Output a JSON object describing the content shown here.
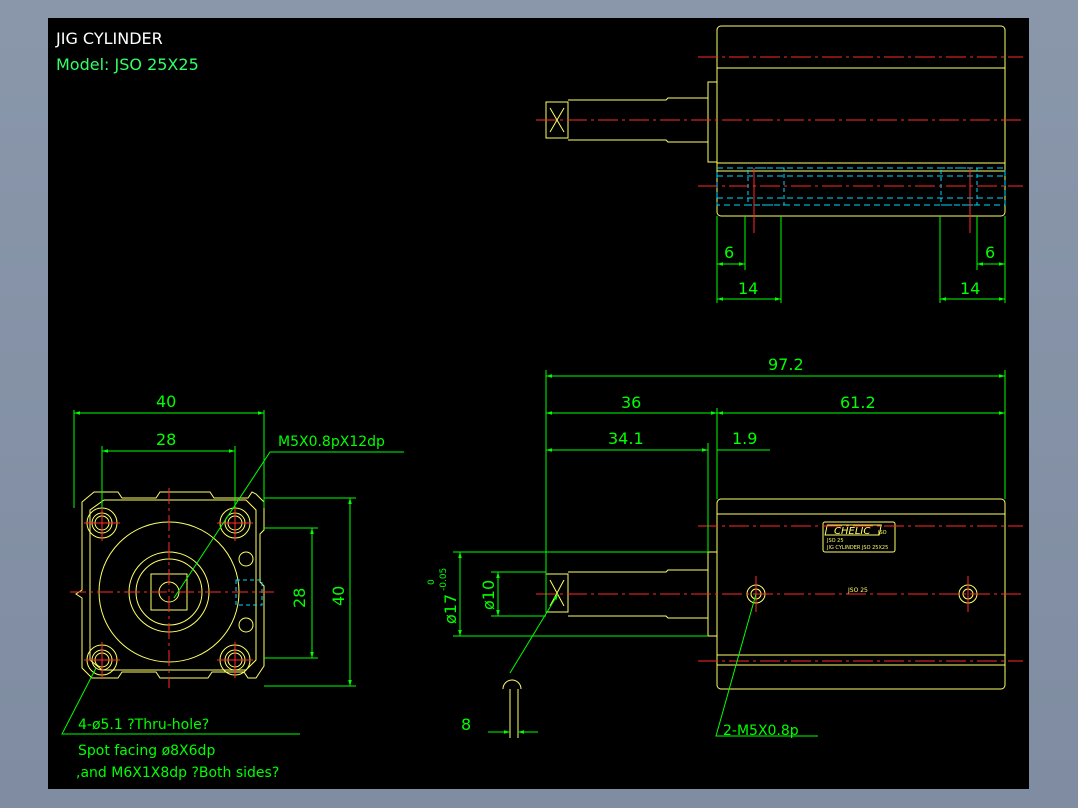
{
  "colors": {
    "outline": "#ffff66",
    "dimension": "#00ff00",
    "center": "#ff2a2a",
    "hidden": "#00d8ff",
    "title": "#ffffff",
    "model": "#33ff66"
  },
  "title": "JIG CYLINDER",
  "model": "Model:  JSO 25X25",
  "dims": {
    "top_left_6": "6",
    "top_right_6": "6",
    "top_left_14": "14",
    "top_right_14": "14",
    "overall": "97.2",
    "d36": "36",
    "d61": "61.2",
    "d34": "34.1",
    "d19": "1.9",
    "front_40": "40",
    "front_28": "28",
    "side_28": "28",
    "side_40": "40",
    "rod_dia": "ø10",
    "bore_dia": "ø17",
    "tol_upper": "0",
    "tol_lower": "-0.05",
    "d8": "8"
  },
  "notes": {
    "m5_thread": "M5X0.8pX12dp",
    "holes": "4-ø5.1 ?Thru-hole?",
    "spot": "Spot facing  ø8X6dp",
    "m6": ",and M6X1X8dp ?Both sides?",
    "ports": "2-M5X0.8p"
  },
  "labels": {
    "brand": "CHELIC",
    "brand_suffix": "JSO",
    "plate_line1": "JSO 25",
    "plate_line2": "JIG CYLINDER  JSO 25X25",
    "body_model": "JSO 25"
  }
}
